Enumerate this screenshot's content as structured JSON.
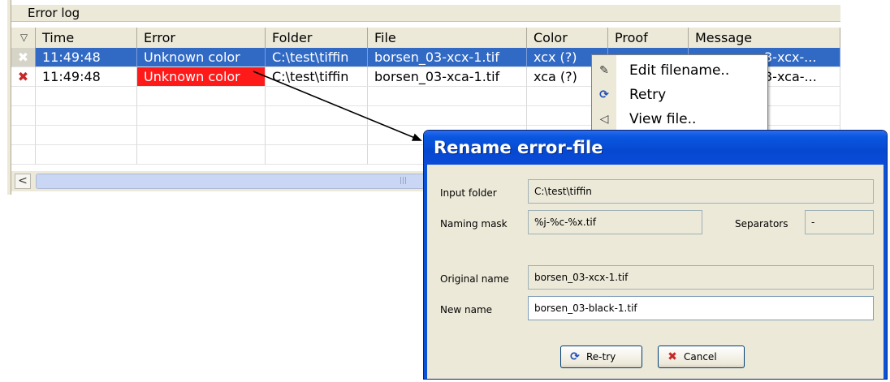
{
  "error_log": {
    "title": "Error log",
    "columns": [
      "Time",
      "Error",
      "Folder",
      "File",
      "Color",
      "Proof",
      "Message"
    ],
    "rows": [
      {
        "status_icon": "✖",
        "time": "11:49:48",
        "error": "Unknown color",
        "folder": "C:\\test\\tiffin",
        "file": "borsen_03-xcx-1.tif",
        "color": "xcx (?)",
        "proof": "",
        "message": "3-xcx-..."
      },
      {
        "status_icon": "✖",
        "time": "11:49:48",
        "error": "Unknown color",
        "folder": "C:\\test\\tiffin",
        "file": "borsen_03-xca-1.tif",
        "color": "xca (?)",
        "proof": "",
        "message": "3-xca-..."
      }
    ],
    "scroll_left": "<"
  },
  "context_menu": {
    "items": [
      {
        "label": "Edit filename..",
        "icon": "edit-file-icon"
      },
      {
        "label": "Retry",
        "icon": "retry-icon"
      },
      {
        "label": "View file..",
        "icon": "view-file-icon"
      }
    ]
  },
  "rename_dialog": {
    "title": "Rename error-file",
    "input_folder_label": "Input folder",
    "input_folder_value": "C:\\test\\tiffin",
    "naming_mask_label": "Naming mask",
    "naming_mask_value": "%j-%c-%x.tif",
    "separators_label": "Separators",
    "separators_value": "-",
    "original_name_label": "Original name",
    "original_name_value": "borsen_03-xcx-1.tif",
    "new_name_label": "New name",
    "new_name_value": "borsen_03-black-1.tif",
    "retry_button": "Re-try",
    "cancel_button": "Cancel"
  },
  "colors": {
    "selection": "#316ac5",
    "error_highlight": "#ff1a1a",
    "title_bar": "#0648d0",
    "dialog_bg": "#ece9d8"
  }
}
